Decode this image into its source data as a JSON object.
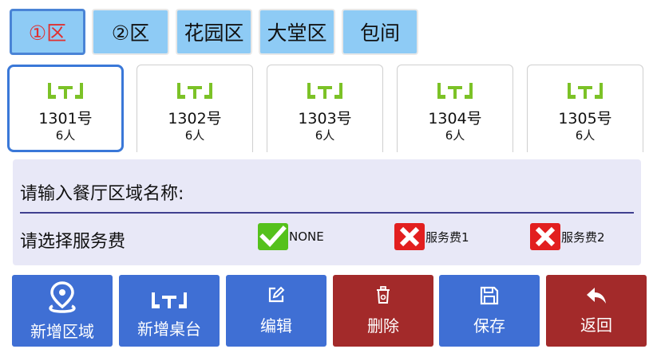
{
  "zones": [
    {
      "label": "①区",
      "active": true
    },
    {
      "label": "②区",
      "active": false
    },
    {
      "label": "花园区",
      "active": false
    },
    {
      "label": "大堂区",
      "active": false
    },
    {
      "label": "包间",
      "active": false
    }
  ],
  "tables": [
    {
      "name": "1301号",
      "seats": "6人",
      "icon": "dining-table-icon",
      "active": true
    },
    {
      "name": "1302号",
      "seats": "6人",
      "icon": "dining-table-icon",
      "active": false
    },
    {
      "name": "1303号",
      "seats": "6人",
      "icon": "dining-table-icon",
      "active": false
    },
    {
      "name": "1304号",
      "seats": "6人",
      "icon": "dining-table-icon",
      "active": false
    },
    {
      "name": "1305号",
      "seats": "6人",
      "icon": "dining-table-icon",
      "active": false
    }
  ],
  "form": {
    "name_label": "请输入餐厅区域名称:",
    "name_value": "",
    "fee_label": "请选择服务费",
    "fee_options": [
      {
        "label": "NONE",
        "checked": true
      },
      {
        "label": "服务费1",
        "checked": false
      },
      {
        "label": "服务费2",
        "checked": false
      }
    ]
  },
  "actions": [
    {
      "label": "新增区域",
      "icon": "location-pin-icon",
      "color": "#3f6fd4"
    },
    {
      "label": "新增桌台",
      "icon": "dining-table-icon",
      "color": "#3f6fd4"
    },
    {
      "label": "编辑",
      "icon": "edit-icon",
      "color": "#3f6fd4"
    },
    {
      "label": "删除",
      "icon": "trash-icon",
      "color": "#a32a2a"
    },
    {
      "label": "保存",
      "icon": "save-icon",
      "color": "#3f6fd4"
    },
    {
      "label": "返回",
      "icon": "reply-arrow-icon",
      "color": "#a32a2a"
    }
  ],
  "colors": {
    "zone_tab_bg": "#8ecbf5",
    "active_zone_text": "#e03030",
    "table_icon": "#7cc227",
    "panel_bg": "#e8e8f7",
    "check_green": "#55c11c",
    "cross_red": "#e21f1f",
    "action_blue": "#3f6fd4",
    "action_red": "#a32a2a"
  }
}
